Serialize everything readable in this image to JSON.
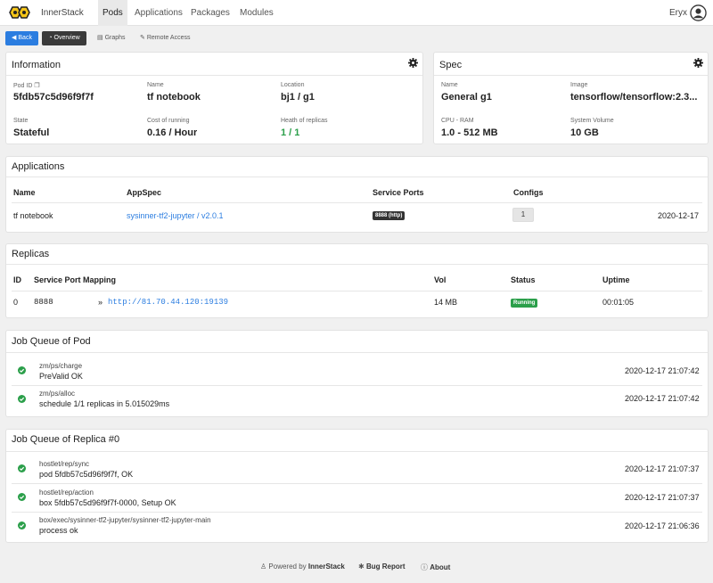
{
  "nav": {
    "brand": "InnerStack",
    "links": [
      "Pods",
      "Applications",
      "Packages",
      "Modules"
    ],
    "user": "Eryx"
  },
  "subnav": {
    "back": "Back",
    "overview": "Overview",
    "graphs": "Graphs",
    "remote": "Remote Access"
  },
  "info": {
    "title": "Information",
    "pod_id_label": "Pod ID",
    "pod_id": "5fdb57c5d96f9f7f",
    "name_label": "Name",
    "name": "tf notebook",
    "location_label": "Location",
    "location": "bj1 / g1",
    "state_label": "State",
    "state": "Stateful",
    "cost_label": "Cost of running",
    "cost": "0.16 / Hour",
    "health_label": "Heath of replicas",
    "health": "1 / 1"
  },
  "spec": {
    "title": "Spec",
    "name_label": "Name",
    "name": "General g1",
    "image_label": "Image",
    "image": "tensorflow/tensorflow:2.3...",
    "cpu_label": "CPU - RAM",
    "cpu": "1.0 - 512 MB",
    "volume_label": "System Volume",
    "volume": "10 GB"
  },
  "apps": {
    "title": "Applications",
    "headers": [
      "Name",
      "AppSpec",
      "Service Ports",
      "Configs"
    ],
    "row": {
      "name": "tf notebook",
      "appspec": "sysinner-tf2-jupyter / v2.0.1",
      "port": "8888 (http)",
      "configs": "1",
      "date": "2020-12-17"
    }
  },
  "replicas": {
    "title": "Replicas",
    "headers": [
      "ID",
      "Service Port Mapping",
      "Vol",
      "Status",
      "Uptime"
    ],
    "row": {
      "id": "0",
      "port": "8888",
      "arrow": "»",
      "url": "http://81.70.44.120:19139",
      "vol": "14 MB",
      "status": "Running",
      "uptime": "00:01:05"
    }
  },
  "pod_jobs": {
    "title": "Job Queue of Pod",
    "items": [
      {
        "name": "zm/ps/charge",
        "msg": "PreValid OK",
        "time": "2020-12-17 21:07:42"
      },
      {
        "name": "zm/ps/alloc",
        "msg": "schedule 1/1 replicas in 5.015029ms",
        "time": "2020-12-17 21:07:42"
      }
    ]
  },
  "replica_jobs": {
    "title": "Job Queue of Replica #0",
    "items": [
      {
        "name": "hostlet/rep/sync",
        "msg": "pod 5fdb57c5d96f9f7f, OK",
        "time": "2020-12-17 21:07:37"
      },
      {
        "name": "hostlet/rep/action",
        "msg": "box 5fdb57c5d96f9f7f-0000, Setup OK",
        "time": "2020-12-17 21:07:37"
      },
      {
        "name": "box/exec/sysinner-tf2-jupyter/sysinner-tf2-jupyter-main",
        "msg": "process ok",
        "time": "2020-12-17 21:06:36"
      }
    ]
  },
  "footer": {
    "powered": "Powered by",
    "powered_brand": "InnerStack",
    "bug": "Bug Report",
    "about": "About"
  },
  "colors": {
    "accent": "#2b7de0",
    "success": "#2b9f4a",
    "dark_button": "#3a3a3a"
  }
}
